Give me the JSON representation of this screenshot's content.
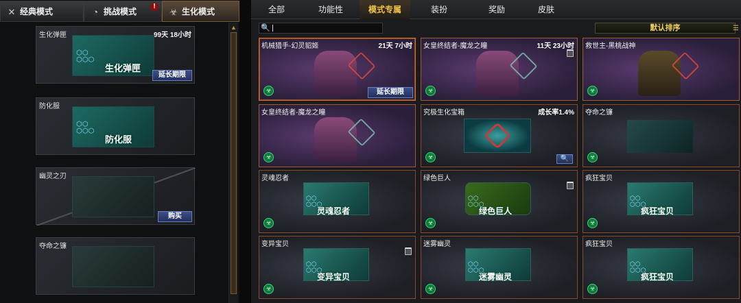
{
  "mode_tabs": [
    {
      "label": "经典模式",
      "icon": "crossed-swords-icon",
      "active": false
    },
    {
      "label": "挑战模式",
      "icon": "speedometer-icon",
      "active": false,
      "alert": "!"
    },
    {
      "label": "生化模式",
      "icon": "biohazard-icon",
      "active": true
    }
  ],
  "left_items": [
    {
      "title": "生化弹匣",
      "time": "99天 18小时",
      "label": "生化弹匣",
      "button": "延长期限"
    },
    {
      "title": "防化服",
      "label": "防化服"
    },
    {
      "title": "幽灵之刃",
      "button": "购买"
    },
    {
      "title": "夺命之镰"
    }
  ],
  "category_tabs": [
    {
      "label": "全部",
      "active": false
    },
    {
      "label": "功能性",
      "active": false
    },
    {
      "label": "模式专属",
      "active": true
    },
    {
      "label": "装扮",
      "active": false
    },
    {
      "label": "奖励",
      "active": false
    },
    {
      "label": "皮肤",
      "active": false
    }
  ],
  "search": {
    "value": ""
  },
  "sort": {
    "label": "默认排序"
  },
  "grid_items": [
    {
      "title": "机械猎手-幻灵貂姬",
      "time": "21天 7小时",
      "button": "延长期限",
      "style": "purple"
    },
    {
      "title": "女皇终结者-魔龙之瞳",
      "time": "11天 23小时",
      "trash": true,
      "style": "purple"
    },
    {
      "title": "救世主-黑桃战神",
      "style": "purple"
    },
    {
      "title": "女皇终结者-魔龙之瞳",
      "style": "purple"
    },
    {
      "title": "究极生化宝箱",
      "time": "成长率1.4%",
      "magnifier": true,
      "style": "dark"
    },
    {
      "title": "夺命之镰",
      "style": "dark"
    },
    {
      "title": "灵魂忍者",
      "label": "灵魂忍者",
      "style": "dark"
    },
    {
      "title": "绿色巨人",
      "label": "绿色巨人",
      "trash": true,
      "style": "dark"
    },
    {
      "title": "疯狂宝贝",
      "label": "疯狂宝贝",
      "style": "dark"
    },
    {
      "title": "变异宝贝",
      "label": "变异宝贝",
      "trash": true,
      "style": "dark"
    },
    {
      "title": "迷雾幽灵",
      "label": "迷雾幽灵",
      "style": "dark"
    },
    {
      "title": "疯狂宝贝",
      "label": "疯狂宝贝",
      "style": "dark"
    }
  ]
}
